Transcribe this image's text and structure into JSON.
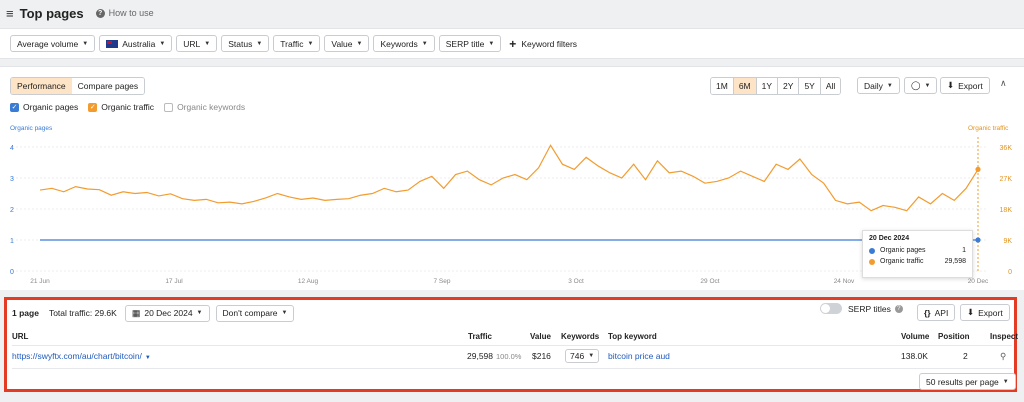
{
  "header": {
    "title": "Top pages",
    "help": "How to use"
  },
  "filters": {
    "average_volume": "Average volume",
    "country": "Australia",
    "url": "URL",
    "status": "Status",
    "traffic": "Traffic",
    "value": "Value",
    "keywords": "Keywords",
    "serp_title": "SERP title",
    "keyword_filters": "Keyword filters"
  },
  "chart_panel": {
    "tabs": [
      "Performance",
      "Compare pages"
    ],
    "ranges": [
      "1M",
      "6M",
      "1Y",
      "2Y",
      "5Y",
      "All"
    ],
    "active_range": "6M",
    "interval": "Daily",
    "export": "Export",
    "legend": [
      "Organic pages",
      "Organic traffic",
      "Organic keywords"
    ],
    "left_axis_title": "Organic pages",
    "right_axis_title": "Organic traffic"
  },
  "chart_data": {
    "type": "line",
    "x_range": [
      "21 Jun",
      "20 Dec"
    ],
    "x_tick_labels": [
      "21 Jun",
      "17 Jul",
      "12 Aug",
      "7 Sep",
      "3 Oct",
      "29 Oct",
      "24 Nov",
      "20 Dec"
    ],
    "left_y_ticks": [
      "0",
      "1",
      "2",
      "3",
      "4"
    ],
    "right_y_ticks": [
      "0",
      "9K",
      "18K",
      "27K",
      "36K"
    ],
    "ylim_left": [
      0,
      4
    ],
    "ylim_right": [
      0,
      36000
    ],
    "series": [
      {
        "name": "Organic pages",
        "axis": "left",
        "color": "#3a7bd5",
        "values": [
          1,
          1,
          1,
          1,
          1,
          1,
          1,
          1
        ]
      },
      {
        "name": "Organic traffic",
        "axis": "right",
        "color": "#f29c2f",
        "values": [
          23500,
          24000,
          23000,
          24500,
          23800,
          23600,
          22000,
          23000,
          22500,
          22800,
          21800,
          22400,
          21000,
          20500,
          20800,
          19800,
          20000,
          19500,
          20200,
          21200,
          22500,
          21500,
          20800,
          21200,
          20500,
          20800,
          21000,
          22000,
          22500,
          24000,
          23000,
          23500,
          26000,
          27500,
          24000,
          28000,
          29000,
          26500,
          25000,
          27000,
          28000,
          26500,
          30000,
          36500,
          31000,
          29500,
          33000,
          30500,
          28500,
          27000,
          31000,
          26500,
          32000,
          28500,
          29000,
          27500,
          25500,
          26000,
          27000,
          29000,
          27500,
          26000,
          31000,
          29500,
          32500,
          28000,
          25500,
          20500,
          19500,
          20000,
          17500,
          19000,
          18500,
          17500,
          21500,
          19500,
          22500,
          20500,
          24000,
          29500
        ]
      }
    ]
  },
  "tooltip": {
    "date": "20 Dec 2024",
    "rows": [
      {
        "label": "Organic pages",
        "value": "1",
        "color": "#3a7bd5"
      },
      {
        "label": "Organic traffic",
        "value": "29,598",
        "color": "#f29c2f"
      }
    ]
  },
  "table_panel": {
    "pages": "1 page",
    "total_traffic": "Total traffic: 29.6K",
    "date": "20 Dec 2024",
    "compare": "Don't compare",
    "serp_titles": "SERP titles",
    "api": "API",
    "export": "Export",
    "columns": [
      "URL",
      "Traffic",
      "Value",
      "Keywords",
      "Top keyword",
      "Volume",
      "Position",
      "Inspect"
    ],
    "row": {
      "url": "https://swyftx.com/au/chart/bitcoin/",
      "traffic": "29,598",
      "traffic_pct": "100.0%",
      "value": "$216",
      "keywords": "746",
      "top_keyword": "bitcoin price aud",
      "volume": "138.0K",
      "position": "2"
    },
    "per_page": "50 results per page"
  }
}
